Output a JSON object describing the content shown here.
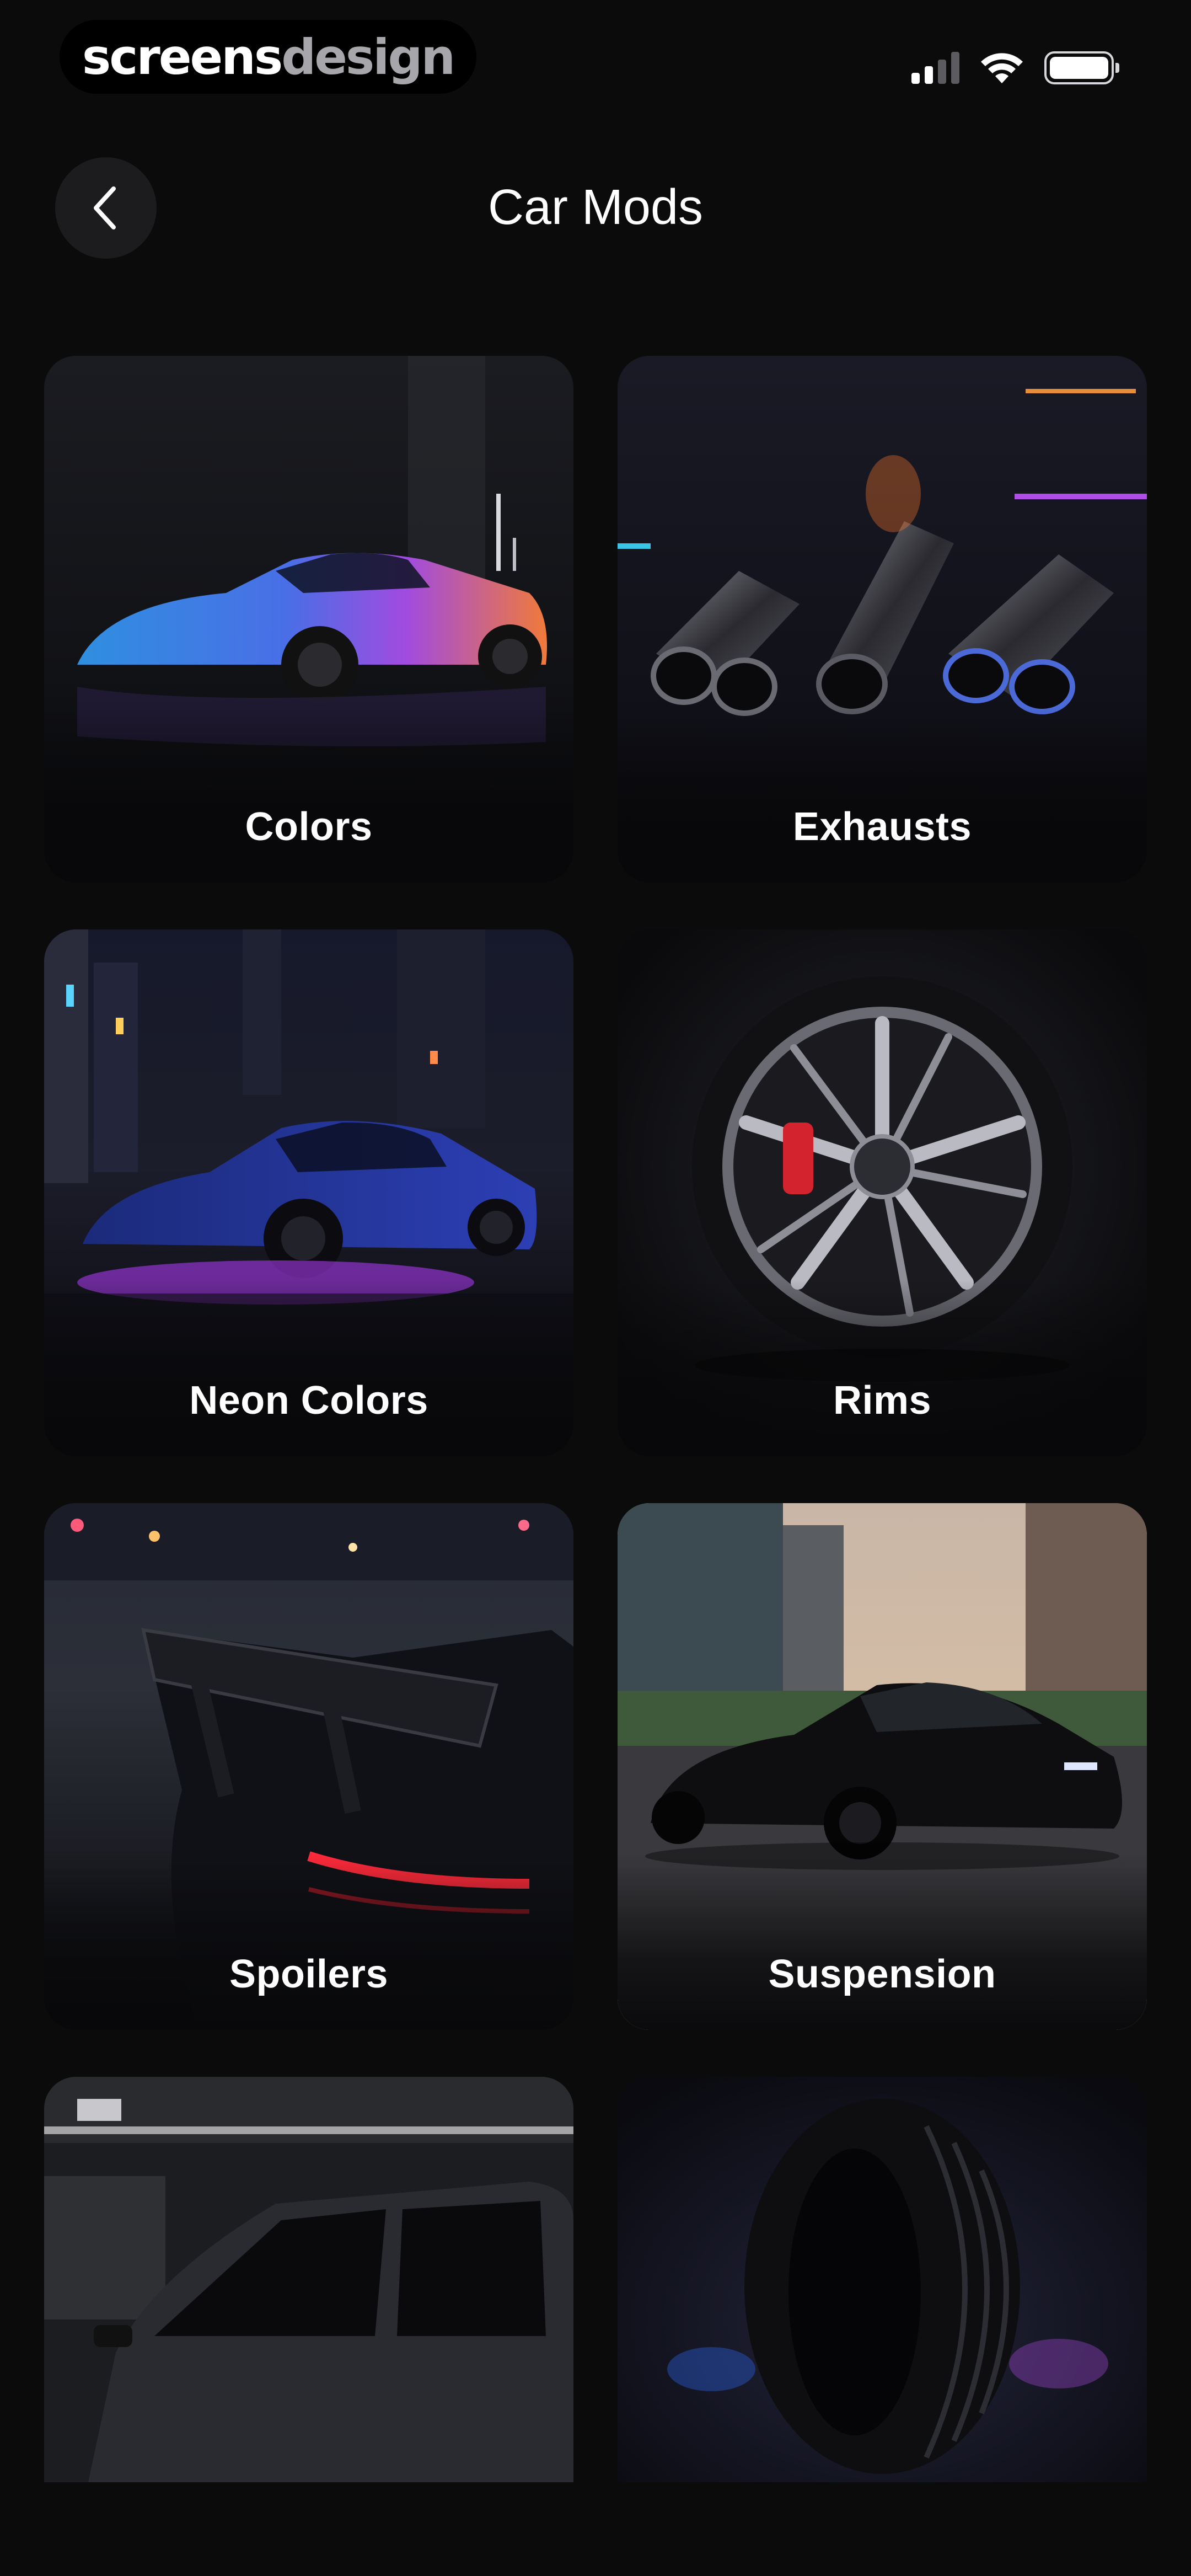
{
  "status_bar": {
    "brand_part1": "screens",
    "brand_part2": "design",
    "icons": [
      "cellular-signal-icon",
      "wifi-icon",
      "battery-icon"
    ]
  },
  "header": {
    "title": "Car Mods",
    "back_icon": "chevron-left-icon"
  },
  "categories": [
    {
      "label": "Colors",
      "image": "multicolor-sports-car-photo"
    },
    {
      "label": "Exhausts",
      "image": "exhaust-tips-photo"
    },
    {
      "label": "Neon Colors",
      "image": "car-with-neon-underglow-photo"
    },
    {
      "label": "Rims",
      "image": "wheel-rim-photo"
    },
    {
      "label": "Spoilers",
      "image": "rear-wing-spoiler-photo"
    },
    {
      "label": "Suspension",
      "image": "lowered-black-car-photo"
    },
    {
      "label": "",
      "image": "tinted-windows-car-photo"
    },
    {
      "label": "",
      "image": "tire-photo"
    }
  ],
  "colors": {
    "background": "#0b0b0c",
    "back_button_bg": "#1c1c1e",
    "text": "#ffffff"
  }
}
